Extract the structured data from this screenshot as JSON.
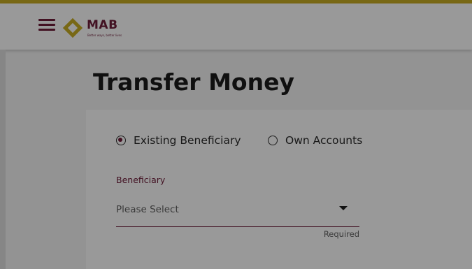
{
  "brand": {
    "name": "MAB",
    "tagline": "Better ways, better lives",
    "accent_color": "#6f1d3a",
    "gold_color": "#c9ad23",
    "logo_icon": "mab-diamond-logo",
    "menu_icon": "hamburger-menu-icon"
  },
  "page": {
    "title": "Transfer Money"
  },
  "transfer_type": {
    "options": [
      {
        "label": "Existing Beneficiary",
        "selected": true
      },
      {
        "label": "Own Accounts",
        "selected": false
      }
    ]
  },
  "beneficiary": {
    "label": "Beneficiary",
    "placeholder": "Please Select",
    "hint": "Required",
    "caret_icon": "caret-down-icon"
  },
  "modal_overlay": {
    "dim_color": "rgba(0,0,0,0.4)"
  }
}
